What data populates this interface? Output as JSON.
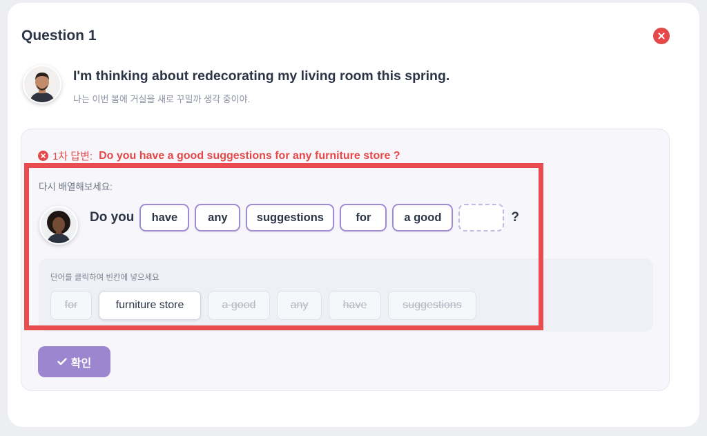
{
  "question": {
    "title": "Question 1"
  },
  "prompt": {
    "english": "I'm thinking about redecorating my living room this spring.",
    "korean": "나는 이번 봄에 거실을 새로 꾸밀까 생각 중이야."
  },
  "first_answer": {
    "label": "1차 답변:",
    "text": "Do you have a good suggestions for any furniture store ?"
  },
  "rearrange": {
    "label": "다시 배열해보세요:",
    "prefix": "Do you",
    "slots": [
      "have",
      "any",
      "suggestions",
      "for",
      "a good",
      ""
    ],
    "suffix": "?"
  },
  "word_bank": {
    "hint": "단어를 클릭하여 빈칸에 넣으세요",
    "words": [
      {
        "text": "for",
        "used": true
      },
      {
        "text": "furniture store",
        "used": false
      },
      {
        "text": "a good",
        "used": true
      },
      {
        "text": "any",
        "used": true
      },
      {
        "text": "have",
        "used": true
      },
      {
        "text": "suggestions",
        "used": true
      }
    ]
  },
  "confirm": {
    "label": "확인"
  },
  "colors": {
    "error_red": "#e54848",
    "highlight_red": "#e84c4f",
    "accent_purple": "#9d86d0",
    "slot_border": "#a08ad2"
  },
  "icons": {
    "close": "close-icon",
    "error": "error-x-icon",
    "confirm": "check-icon"
  }
}
